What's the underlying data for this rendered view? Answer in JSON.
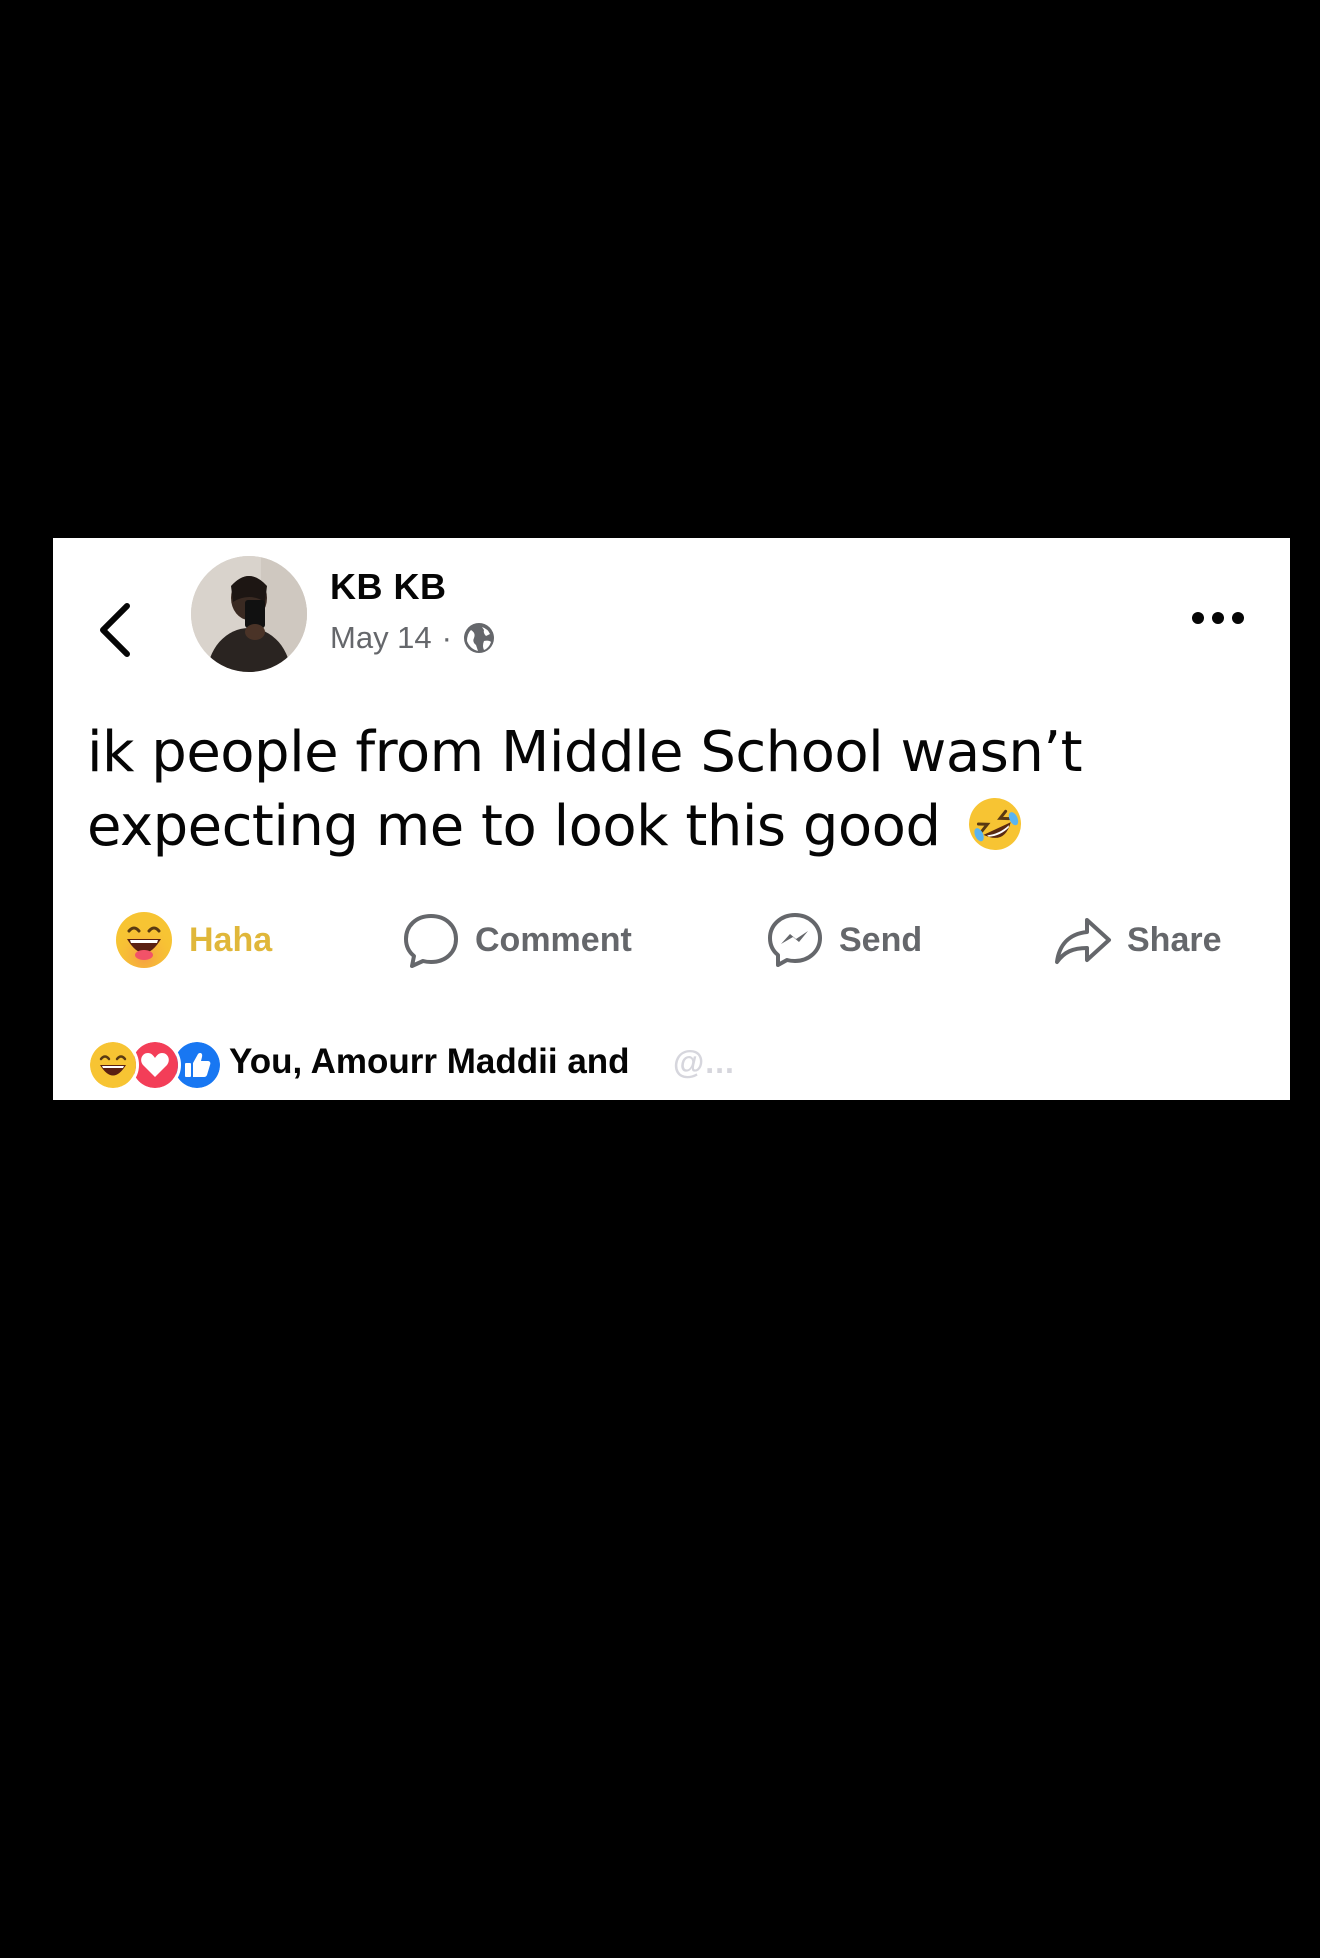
{
  "post": {
    "author": "KB KB",
    "date": "May 14",
    "separator": "·",
    "privacy_icon": "globe-icon",
    "text": "ik people from Middle School wasn’t expecting me to look this good",
    "emoji": "rolling-on-floor-laughing-emoji"
  },
  "actions": {
    "haha_label": "Haha",
    "comment_label": "Comment",
    "send_label": "Send",
    "share_label": "Share"
  },
  "reactions": {
    "icons": [
      "haha-icon",
      "love-icon",
      "like-icon"
    ],
    "summary": "You, Amourr Maddii and"
  },
  "watermark": {
    "text": "@..."
  },
  "colors": {
    "background": "#000000",
    "card": "#ffffff",
    "haha_active": "#e0b73a",
    "muted": "#65676b",
    "like_blue": "#1877f2",
    "love_red": "#f33e58"
  }
}
